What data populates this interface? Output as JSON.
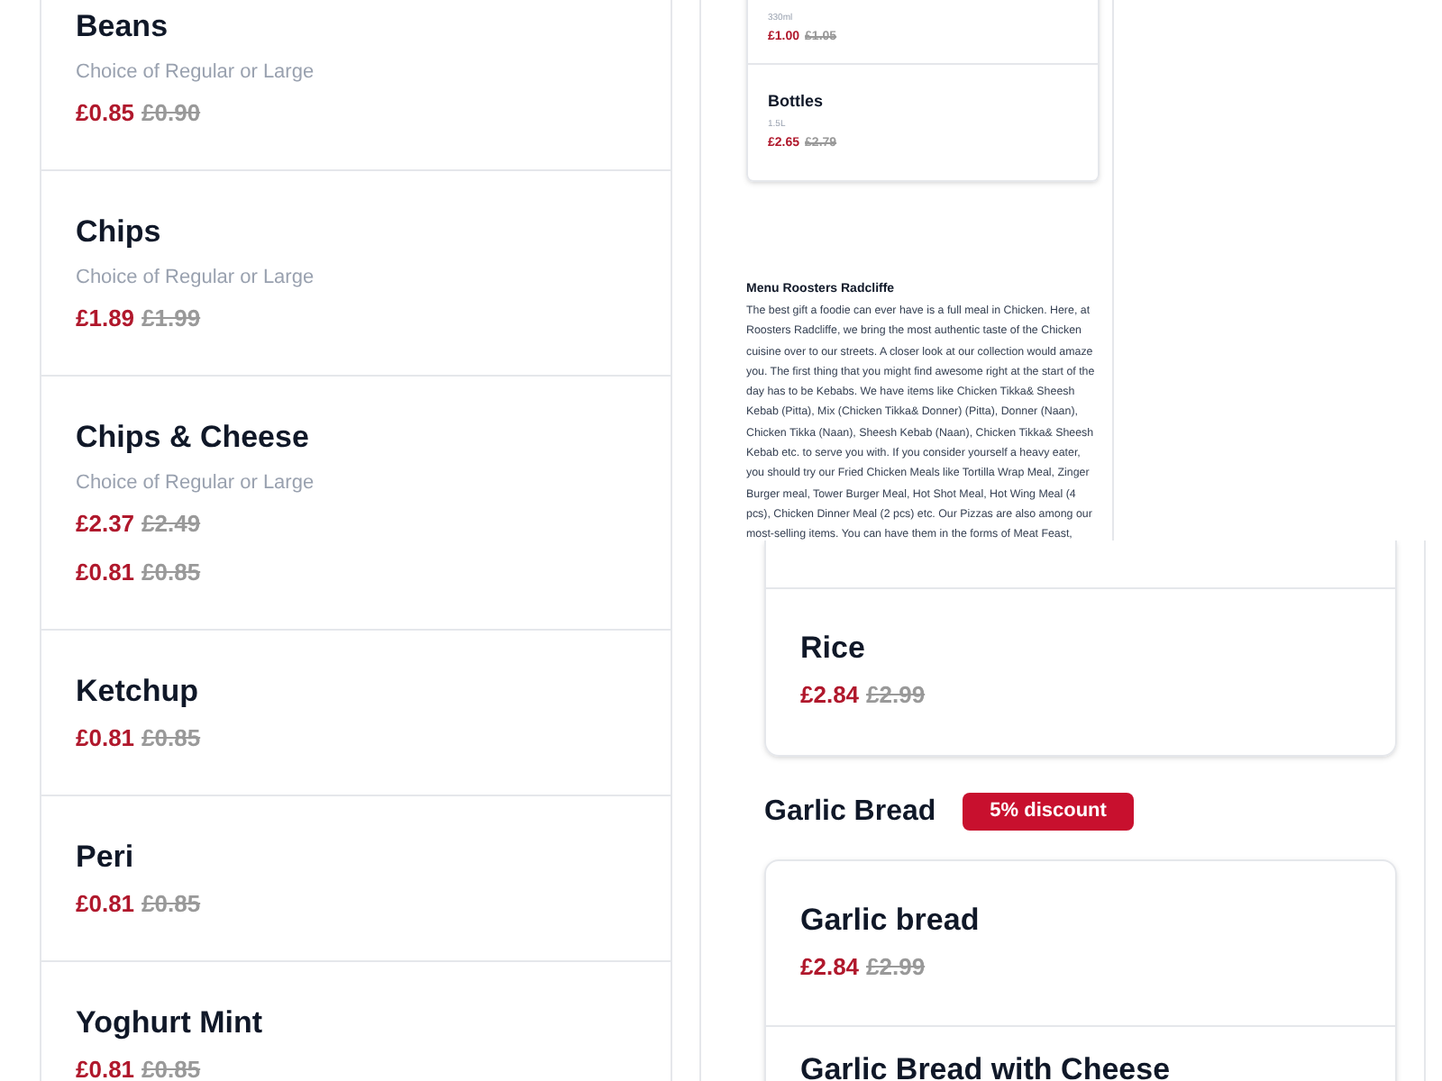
{
  "top_left_items": [
    {
      "name": "Beans",
      "description": "Choice of Regular or Large",
      "price": "£0.85",
      "old_price": "£0.90"
    },
    {
      "name": "Chips",
      "description": "Choice of Regular or Large",
      "price": "£1.89",
      "old_price": "£1.99"
    },
    {
      "name": "Chips & Cheese",
      "description": "Choice of Regular or Large",
      "price": "£2.37",
      "old_price": "£2.49"
    }
  ],
  "drinks": [
    {
      "size": "330ml",
      "price": "£1.00",
      "old_price": "£1.05"
    },
    {
      "name": "Bottles",
      "size": "1.5L",
      "price": "£2.65",
      "old_price": "£2.79"
    }
  ],
  "about": {
    "title": "Menu Roosters Radcliffe",
    "text": "The best gift a foodie can ever have is a full meal in Chicken. Here, at Roosters Radcliffe, we bring the most authentic taste of the Chicken cuisine over to our streets. A closer look at our collection would amaze you. The first thing that you might find awesome right at the start of the day has to be Kebabs. We have items like Chicken Tikka& Sheesh Kebab (Pitta), Mix (Chicken Tikka& Donner) (Pitta), Donner (Naan), Chicken Tikka (Naan), Sheesh Kebab (Naan), Chicken Tikka& Sheesh Kebab etc. to serve you with. If you consider yourself a heavy eater, you should try our Fried Chicken Meals like Tortilla Wrap Meal, Zinger Burger meal, Tower Burger Meal, Hot Shot Meal, Hot Wing Meal (4 pcs), Chicken Dinner Meal (2 pcs) etc. Our Pizzas are also among our most-selling items. You can have them in the forms of Meat Feast,"
  },
  "bottom_left_items": [
    {
      "price": "£0.81",
      "old_price": "£0.85"
    },
    {
      "name": "Ketchup",
      "price": "£0.81",
      "old_price": "£0.85"
    },
    {
      "name": "Peri",
      "price": "£0.81",
      "old_price": "£0.85"
    },
    {
      "name": "Yoghurt Mint",
      "price": "£0.81",
      "old_price": "£0.85"
    }
  ],
  "rice_items": [
    {
      "name": "Rice",
      "price": "£2.84",
      "old_price": "£2.99"
    }
  ],
  "section": {
    "title": "Garlic Bread",
    "badge": "5% discount",
    "items": [
      {
        "name": "Garlic bread",
        "price": "£2.84",
        "old_price": "£2.99"
      },
      {
        "name": "Garlic Bread with Cheese"
      }
    ]
  }
}
